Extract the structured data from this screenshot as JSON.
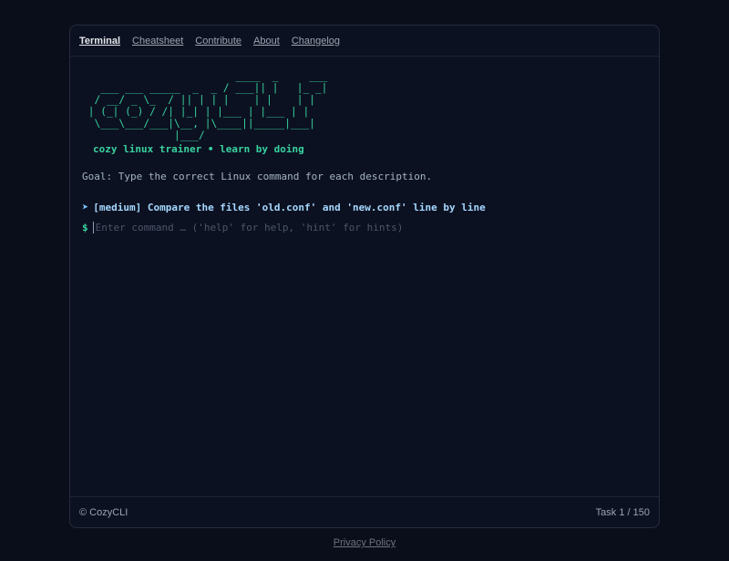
{
  "nav": {
    "items": [
      {
        "label": "Terminal",
        "active": true
      },
      {
        "label": "Cheatsheet",
        "active": false
      },
      {
        "label": "Contribute",
        "active": false
      },
      {
        "label": "About",
        "active": false
      },
      {
        "label": "Changelog",
        "active": false
      }
    ]
  },
  "terminal": {
    "ascii_logo": "                         ____  _     ___\n   ___ ___ _____  _  _ / ___|| |   |_ _|\n  / __/ _ \\_  / || | | |    | |    | |\n | (_| (_) / /| |_| | |___ | |___ | |\n  \\___\\___/___|\\__, |\\____||_____|___|\n               |___/",
    "tagline": "cozy linux trainer • learn by doing",
    "goal": "Goal: Type the correct Linux command for each description.",
    "task_arrow": "➤",
    "task": "[medium] Compare the files 'old.conf' and 'new.conf' line by line",
    "prompt_symbol": "$",
    "input_value": "",
    "input_placeholder": "Enter command … ('help' for help, 'hint' for hints)"
  },
  "footer": {
    "copyright": "© CozyCLI",
    "progress": "Task 1 / 150"
  },
  "privacy_link": "Privacy Policy",
  "colors": {
    "background": "#0a0e1a",
    "panel": "#0c1121",
    "accent_green": "#38d39f",
    "task_blue": "#a5d8ff"
  }
}
